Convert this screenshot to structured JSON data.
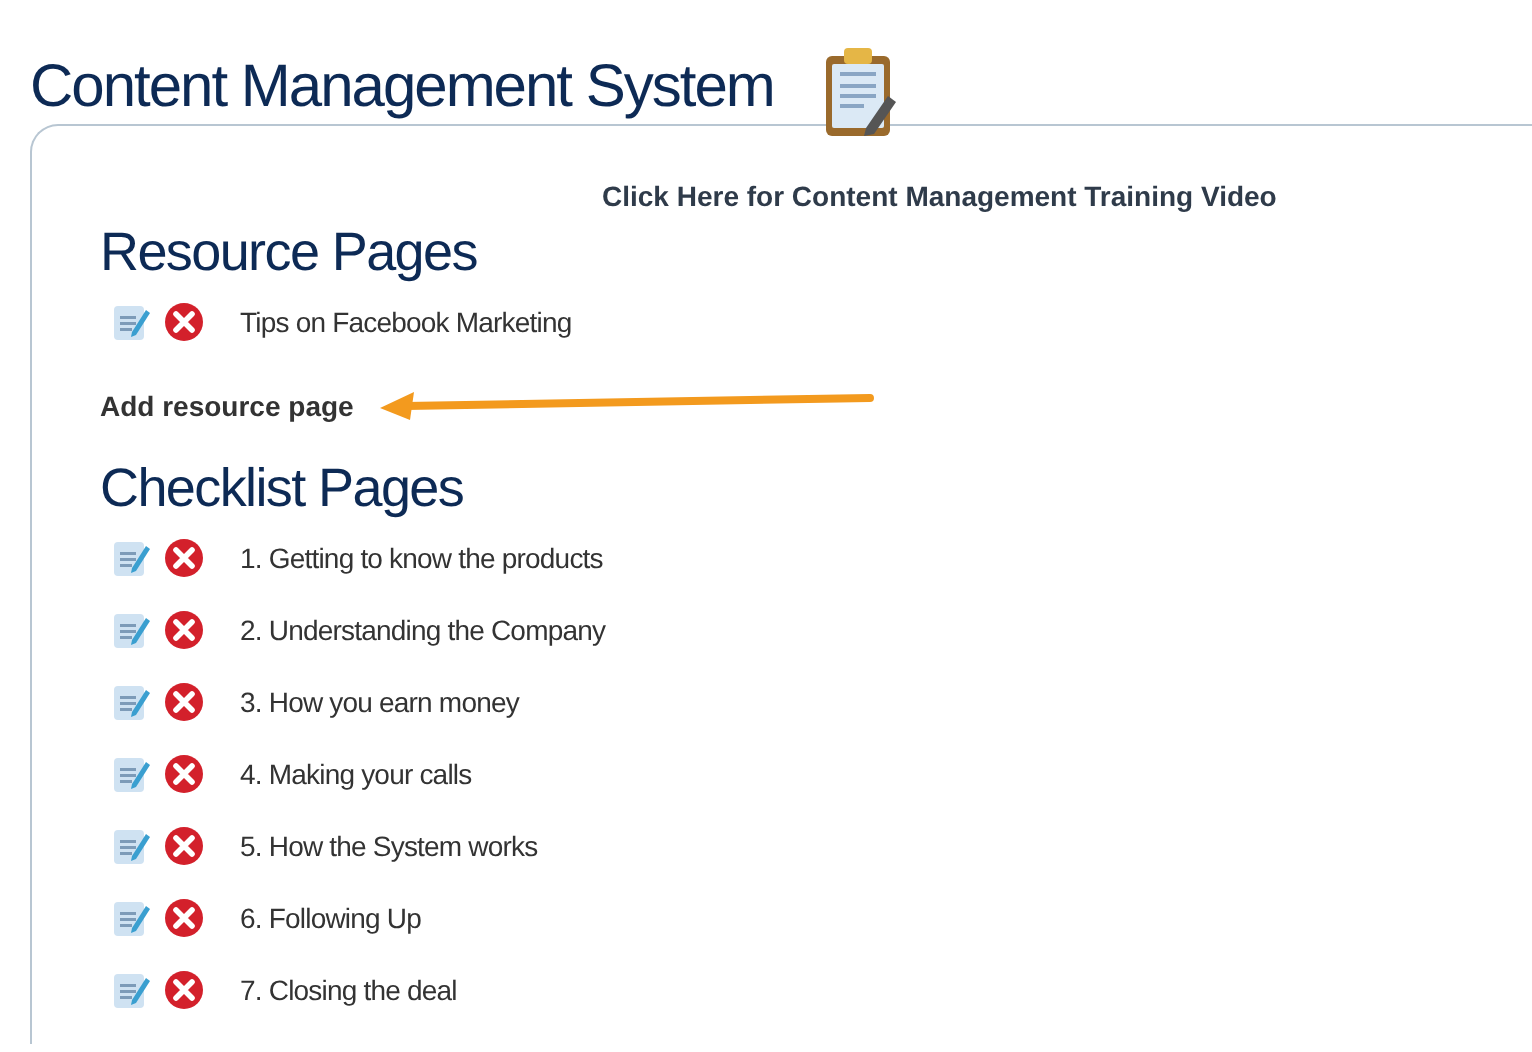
{
  "title": "Content Management System",
  "video_link": "Click Here for Content Management Training Video",
  "sections": [
    {
      "heading": "Resource Pages",
      "add_link": "Add resource page",
      "pages": [
        {
          "label": "Tips on Facebook Marketing"
        }
      ]
    },
    {
      "heading": "Checklist Pages",
      "pages": [
        {
          "label": "1. Getting to know the products"
        },
        {
          "label": "2. Understanding the Company"
        },
        {
          "label": "3. How you earn money"
        },
        {
          "label": "4. Making your calls"
        },
        {
          "label": "5. How the System works"
        },
        {
          "label": "6. Following Up"
        },
        {
          "label": "7. Closing the deal"
        }
      ]
    }
  ]
}
